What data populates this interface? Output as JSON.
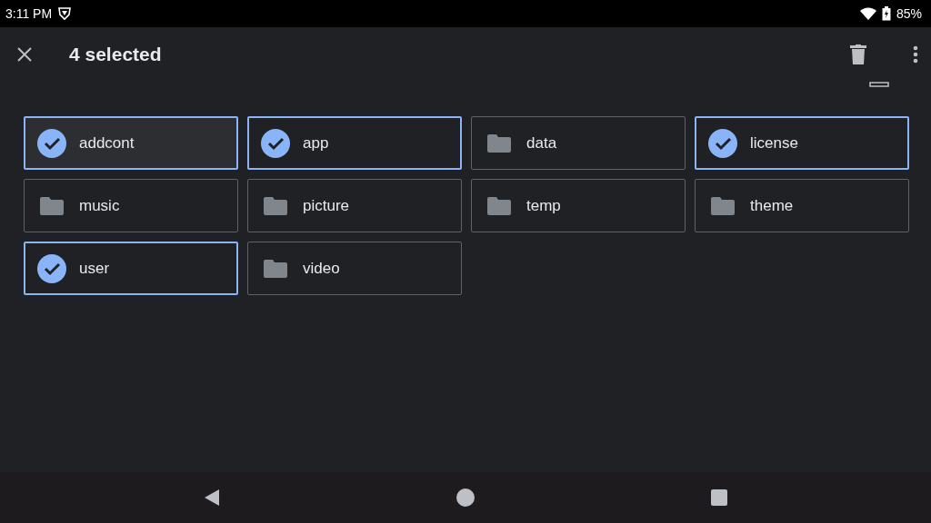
{
  "status_bar": {
    "time": "3:11 PM",
    "battery": "85%"
  },
  "app_bar": {
    "title": "4 selected"
  },
  "folders": [
    {
      "name": "addcont",
      "selected": true,
      "hovered": true
    },
    {
      "name": "app",
      "selected": true,
      "hovered": false
    },
    {
      "name": "data",
      "selected": false,
      "hovered": false
    },
    {
      "name": "license",
      "selected": true,
      "hovered": false
    },
    {
      "name": "music",
      "selected": false,
      "hovered": false
    },
    {
      "name": "picture",
      "selected": false,
      "hovered": false
    },
    {
      "name": "temp",
      "selected": false,
      "hovered": false
    },
    {
      "name": "theme",
      "selected": false,
      "hovered": false
    },
    {
      "name": "user",
      "selected": true,
      "hovered": false
    },
    {
      "name": "video",
      "selected": false,
      "hovered": false
    }
  ]
}
